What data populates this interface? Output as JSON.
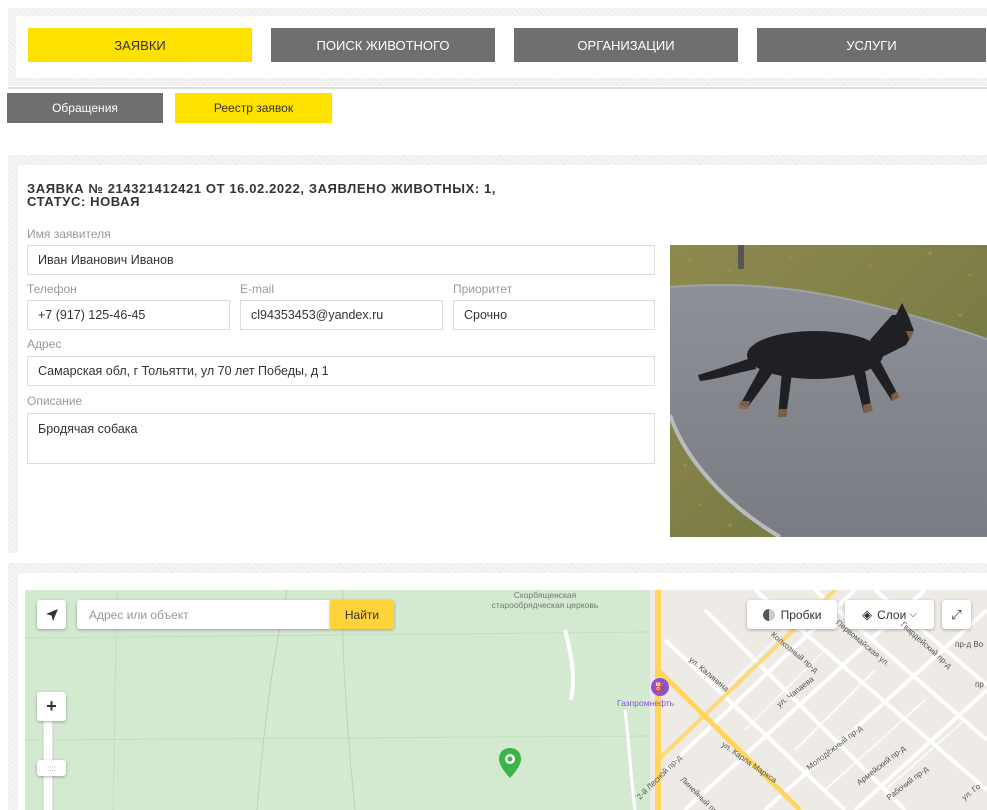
{
  "nav": {
    "items": [
      {
        "label": "Заявки",
        "active": true
      },
      {
        "label": "Поиск животного",
        "active": false
      },
      {
        "label": "Организации",
        "active": false
      },
      {
        "label": "Услуги",
        "active": false
      }
    ]
  },
  "subtabs": {
    "items": [
      {
        "label": "Обращения",
        "active": false
      },
      {
        "label": "Реестр заявок",
        "active": true
      }
    ]
  },
  "request": {
    "title_line1": "Заявка № 214321412421 от 16.02.2022, заявлено животных: 1,",
    "title_line2": "статус: новая",
    "applicant_label": "Имя заявителя",
    "applicant_value": "Иван Иванович Иванов",
    "phone_label": "Телефон",
    "phone_value": "+7 (917) 125-46-45",
    "email_label": "E-mail",
    "email_value": "cl94353453@yandex.ru",
    "priority_label": "Приоритет",
    "priority_value": "Срочно",
    "address_label": "Адрес",
    "address_value": "Самарская обл, г Тольятти, ул 70 лет Победы, д 1",
    "description_label": "Описание",
    "description_value": "Бродячая собака"
  },
  "map": {
    "search_placeholder": "Адрес или объект",
    "search_button": "Найти",
    "traffic_label": "Пробки",
    "layers_label": "Слои",
    "poi_church": "Скорбященская старообрядческая церковь",
    "poi_gas": "Газпромнефть",
    "streets": [
      "ул. Калинина",
      "Колхозный пр-д",
      "Первомайская ул.",
      "Гвардейский пр-д",
      "ул. Чапаева",
      "ул. Карла Маркса",
      "Молодёжный пр-д",
      "Армейский пр-д",
      "Рабочий пр-д",
      "2-й Лесной пр-д",
      "Линейный пр-д",
      "пр-д Во",
      "пр",
      "ул. Го"
    ]
  },
  "colors": {
    "accent": "#ffe100",
    "button_gray": "#6f6f6f",
    "map_green": "#d3ead1",
    "map_road": "#ffd65c",
    "marker_green": "#3bb54a"
  }
}
